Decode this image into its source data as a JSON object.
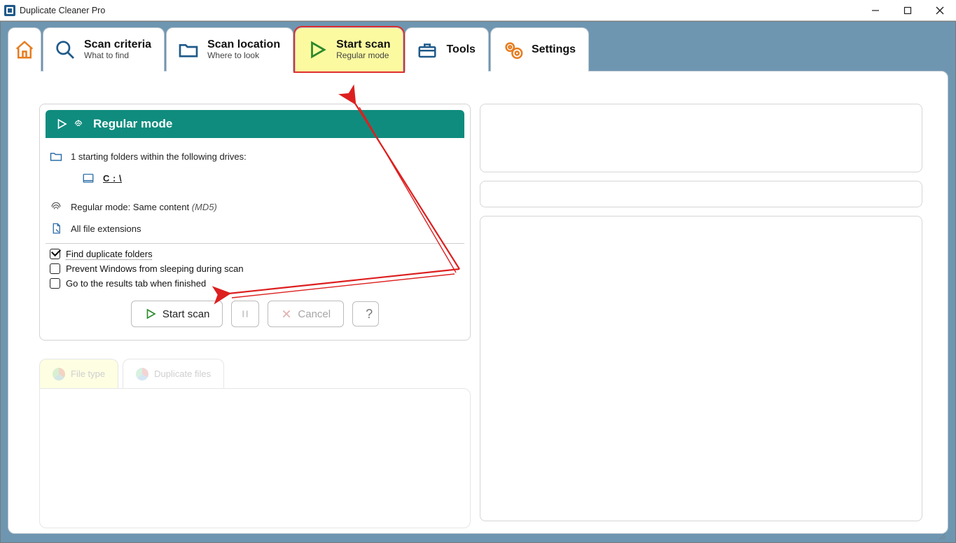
{
  "window": {
    "title": "Duplicate Cleaner Pro"
  },
  "tabs": {
    "criteria": {
      "title": "Scan criteria",
      "sub": "What to find"
    },
    "location": {
      "title": "Scan location",
      "sub": "Where to look"
    },
    "start": {
      "title": "Start scan",
      "sub": "Regular mode"
    },
    "tools": {
      "title": "Tools"
    },
    "settings": {
      "title": "Settings"
    }
  },
  "panel": {
    "mode_title": "Regular mode",
    "starting_folders": "1 starting folders within the following drives:",
    "drive": "C : \\",
    "mode_desc_prefix": "Regular mode: Same content ",
    "mode_desc_hash": "(MD5)",
    "extensions": "All file extensions",
    "opt_find_dup": "Find duplicate folders",
    "opt_prevent_sleep": "Prevent Windows from sleeping during scan",
    "opt_goto_results": "Go to the results tab when finished",
    "btn_start": "Start scan",
    "btn_cancel": "Cancel",
    "btn_help": "?"
  },
  "faint_tabs": {
    "filetype": "File type",
    "dupfiles": "Duplicate files"
  }
}
